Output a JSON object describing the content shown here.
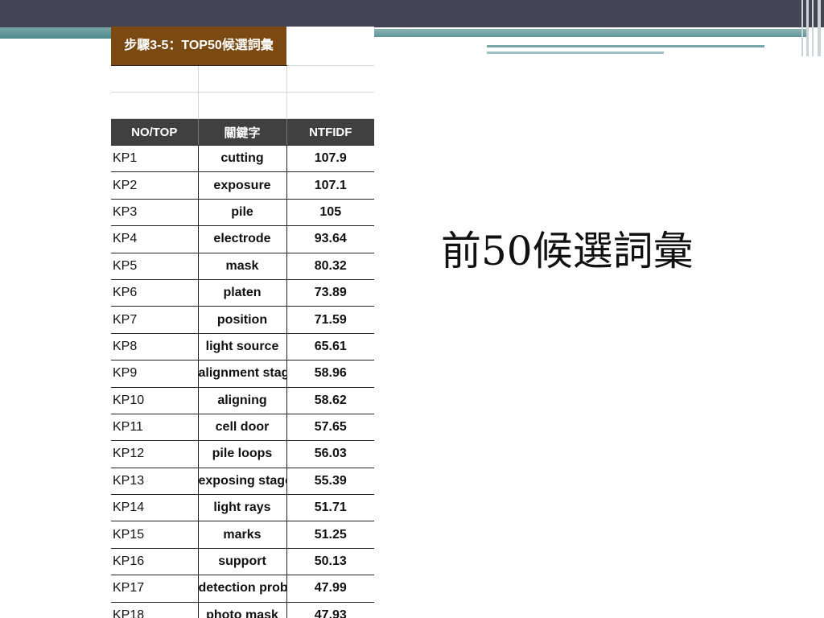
{
  "sheet": {
    "title": "步驟3-5：TOP50候選詞彙",
    "headers": [
      "NO/TOP",
      "關鍵字",
      "NTFIDF"
    ],
    "rows": [
      {
        "no": "KP1",
        "keyword": "cutting",
        "value": "107.9"
      },
      {
        "no": "KP2",
        "keyword": "exposure",
        "value": "107.1"
      },
      {
        "no": "KP3",
        "keyword": "pile",
        "value": "105"
      },
      {
        "no": "KP4",
        "keyword": "electrode",
        "value": "93.64"
      },
      {
        "no": "KP5",
        "keyword": "mask",
        "value": "80.32"
      },
      {
        "no": "KP6",
        "keyword": "platen",
        "value": "73.89"
      },
      {
        "no": "KP7",
        "keyword": "position",
        "value": "71.59"
      },
      {
        "no": "KP8",
        "keyword": "light source",
        "value": "65.61"
      },
      {
        "no": "KP9",
        "keyword": "alignment stage",
        "value": "58.96"
      },
      {
        "no": "KP10",
        "keyword": "aligning",
        "value": "58.62"
      },
      {
        "no": "KP11",
        "keyword": "cell door",
        "value": "57.65"
      },
      {
        "no": "KP12",
        "keyword": "pile loops",
        "value": "56.03"
      },
      {
        "no": "KP13",
        "keyword": "exposing stage",
        "value": "55.39"
      },
      {
        "no": "KP14",
        "keyword": "light rays",
        "value": "51.71"
      },
      {
        "no": "KP15",
        "keyword": "marks",
        "value": "51.25"
      },
      {
        "no": "KP16",
        "keyword": "support",
        "value": "50.13"
      },
      {
        "no": "KP17",
        "keyword": "detection probe b",
        "value": "47.99"
      },
      {
        "no": "KP18",
        "keyword": "photo mask",
        "value": "47.93"
      }
    ]
  },
  "caption": "前50候選詞彙"
}
